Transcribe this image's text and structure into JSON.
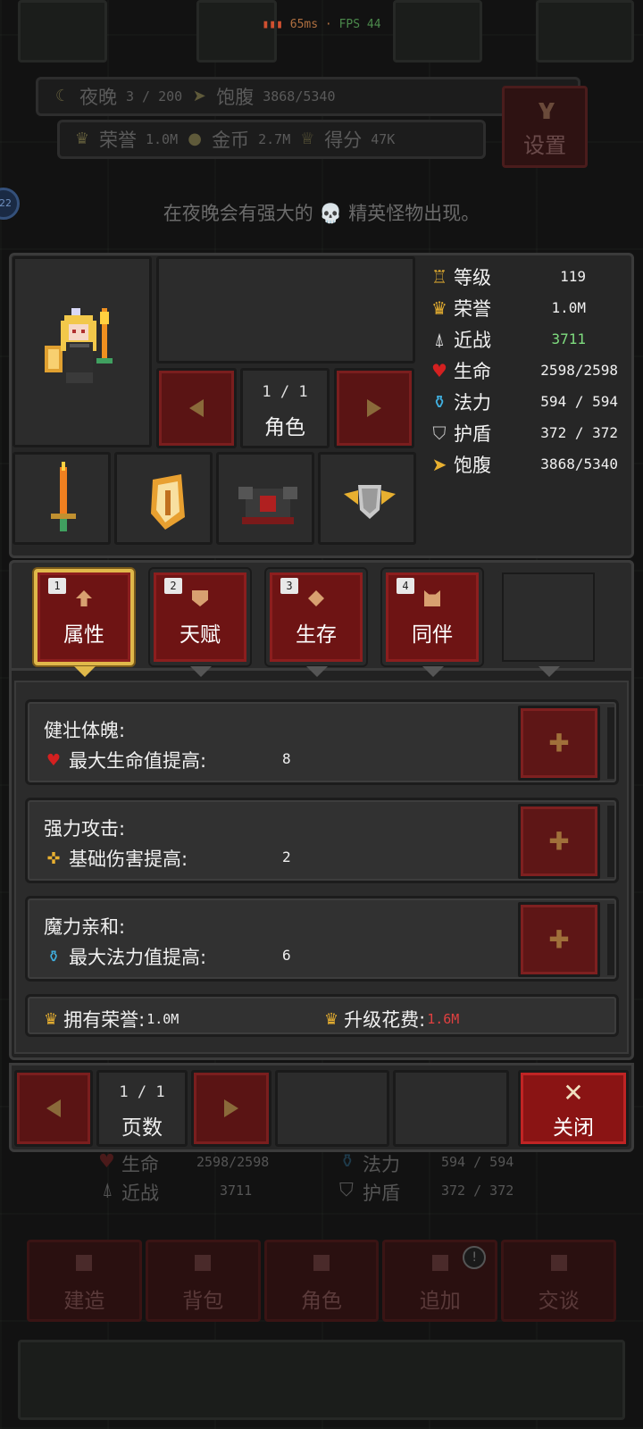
{
  "status": {
    "ping": "65ms",
    "fps": "FPS 44"
  },
  "hud": {
    "night_label": "夜晚",
    "night_value": "3  / 200",
    "satiety_label": "饱腹",
    "satiety_value": "3868/5340",
    "honor_label": "荣誉",
    "honor_value": "1.0M",
    "gold_label": "金币",
    "gold_value": "2.7M",
    "score_label": "得分",
    "score_value": "47K",
    "settings_label": "设置",
    "side_badge": "22"
  },
  "notice": "在夜晚会有强大的 💀 精英怪物出现。",
  "character": {
    "pager_value": "1  /  1",
    "pager_label": "角色"
  },
  "stats": [
    {
      "icon": "level-icon",
      "glyph": "♖",
      "label": "等级",
      "value": "119",
      "color": "#e8b030"
    },
    {
      "icon": "crown-icon",
      "glyph": "♛",
      "label": "荣誉",
      "value": "1.0M",
      "color": "#e8b030"
    },
    {
      "icon": "melee-icon",
      "glyph": "⍋",
      "label": "近战",
      "value": "3711",
      "color": "#e0e0e0"
    },
    {
      "icon": "heart-icon",
      "glyph": "♥",
      "label": "生命",
      "value": "2598/2598",
      "color": "#d42020"
    },
    {
      "icon": "mana-icon",
      "glyph": "⚱",
      "label": "法力",
      "value": "594 / 594",
      "color": "#40b0e0"
    },
    {
      "icon": "shield-icon",
      "glyph": "⛉",
      "label": "护盾",
      "value": "372 / 372",
      "color": "#c0c0c0"
    },
    {
      "icon": "satiety-icon",
      "glyph": "➤",
      "label": "饱腹",
      "value": "3868/5340",
      "color": "#e8b030"
    }
  ],
  "tabs": [
    {
      "key": "1",
      "label": "属性"
    },
    {
      "key": "2",
      "label": "天赋"
    },
    {
      "key": "3",
      "label": "生存"
    },
    {
      "key": "4",
      "label": "同伴"
    }
  ],
  "attributes": [
    {
      "name": "健壮体魄:",
      "effect": "最大生命值提高:",
      "amount": "8",
      "icon": "heart-icon",
      "glyph": "♥",
      "color": "#d42020"
    },
    {
      "name": "强力攻击:",
      "effect": "基础伤害提高:",
      "amount": "2",
      "icon": "damage-icon",
      "glyph": "✜",
      "color": "#e8b030"
    },
    {
      "name": "魔力亲和:",
      "effect": "最大法力值提高:",
      "amount": "6",
      "icon": "mana-icon",
      "glyph": "⚱",
      "color": "#40b0e0"
    }
  ],
  "honor": {
    "owned_label": "拥有荣誉:",
    "owned_value": "1.0M",
    "cost_label": "升级花费:",
    "cost_value": "1.6M"
  },
  "pager": {
    "value": "1  /  1",
    "label": "页数"
  },
  "close_label": "关闭",
  "background_stats": {
    "hp_label": "生命",
    "hp_value": "2598/2598",
    "mp_label": "法力",
    "mp_value": "594 / 594",
    "melee_label": "近战",
    "melee_value": "3711",
    "shield_label": "护盾",
    "shield_value": "372 / 372"
  },
  "bottom_nav": [
    "建造",
    "背包",
    "角色",
    "追加",
    "交谈"
  ],
  "nav_badge": "!"
}
